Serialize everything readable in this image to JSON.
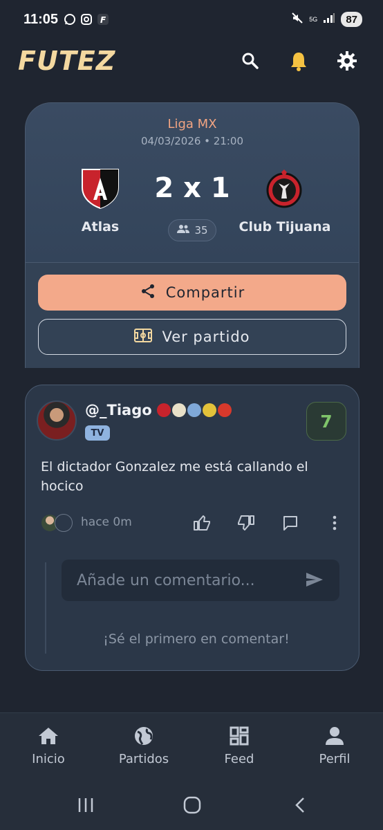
{
  "status_bar": {
    "time": "11:05",
    "network": "5G",
    "battery": "87",
    "app_icons": [
      "whatsapp-icon",
      "instagram-icon",
      "futez-icon"
    ]
  },
  "app_bar": {
    "logo": "FUTEZ",
    "actions": [
      "search-icon",
      "bell-icon",
      "gear-icon"
    ]
  },
  "match": {
    "league": "Liga MX",
    "datetime": "04/03/2026 • 21:00",
    "home_team": "Atlas",
    "away_team": "Club Tijuana",
    "score": "2 x 1",
    "viewers": "35",
    "share_label": "Compartir",
    "watch_label": "Ver partido"
  },
  "post": {
    "username": "@_Tiago",
    "tag": "TV",
    "rating": "7",
    "text": "El dictador Gonzalez me está callando el hocico",
    "time": "hace 0m",
    "comment_placeholder": "Añade un comentario...",
    "empty_comments": "¡Sé el primero en comentar!"
  },
  "bottom_nav": {
    "items": [
      {
        "label": "Inicio",
        "icon": "home-icon"
      },
      {
        "label": "Partidos",
        "icon": "globe-icon"
      },
      {
        "label": "Feed",
        "icon": "dashboard-icon"
      },
      {
        "label": "Perfil",
        "icon": "person-icon"
      }
    ]
  },
  "colors": {
    "background": "#1f2530",
    "accent": "#f3a98a",
    "logo": "#f3d8a0",
    "rating": "#7fc46a"
  }
}
